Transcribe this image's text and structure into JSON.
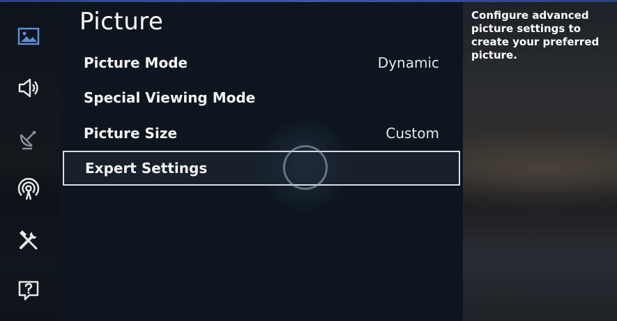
{
  "page": {
    "title": "Picture"
  },
  "sidebar": {
    "items": [
      {
        "icon": "picture-icon",
        "active": true
      },
      {
        "icon": "speaker-icon",
        "active": false
      },
      {
        "icon": "satellite-dish-icon",
        "active": false
      },
      {
        "icon": "broadcast-signal-icon",
        "active": false
      },
      {
        "icon": "tools-icon",
        "active": false
      },
      {
        "icon": "support-question-icon",
        "active": false
      }
    ]
  },
  "menu": {
    "items": [
      {
        "label": "Picture Mode",
        "value": "Dynamic",
        "selected": false
      },
      {
        "label": "Special Viewing Mode",
        "value": "",
        "selected": false
      },
      {
        "label": "Picture Size",
        "value": "Custom",
        "selected": false
      },
      {
        "label": "Expert Settings",
        "value": "",
        "selected": true
      }
    ]
  },
  "info": {
    "description": "Configure advanced picture settings to create your preferred picture."
  },
  "colors": {
    "accent_top_line": "#3a55b8",
    "active_icon": "#5a8fd6",
    "main_panel_bg": "#0d161f",
    "selected_border": "#d9dde3"
  }
}
